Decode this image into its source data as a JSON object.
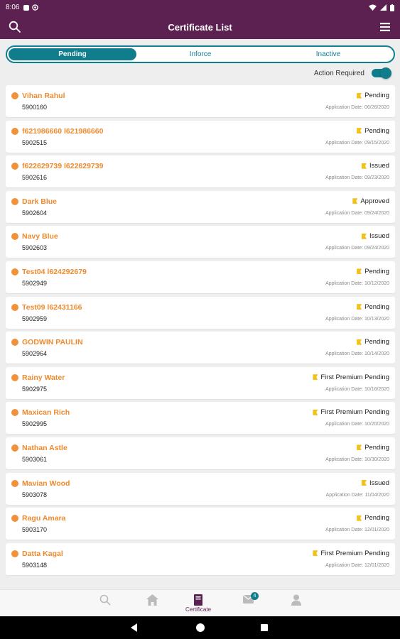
{
  "status_bar": {
    "time": "8:06"
  },
  "header": {
    "title": "Certificate List"
  },
  "tabs": [
    {
      "label": "Pending",
      "active": true
    },
    {
      "label": "Inforce",
      "active": false
    },
    {
      "label": "Inactive",
      "active": false
    }
  ],
  "filter": {
    "action_required_label": "Action Required",
    "action_required_on": true
  },
  "certificates": [
    {
      "name": "Vihan Rahul",
      "number": "5900160",
      "status": "Pending",
      "application_date": "Application Date: 06/26/2020"
    },
    {
      "name": "f621986660 l621986660",
      "number": "5902515",
      "status": "Pending",
      "application_date": "Application Date: 09/15/2020"
    },
    {
      "name": "f622629739 l622629739",
      "number": "5902616",
      "status": "Issued",
      "application_date": "Application Date: 09/23/2020"
    },
    {
      "name": "Dark Blue",
      "number": "5902604",
      "status": "Approved",
      "application_date": "Application Date: 09/24/2020"
    },
    {
      "name": "Navy Blue",
      "number": "5902603",
      "status": "Issued",
      "application_date": "Application Date: 09/24/2020"
    },
    {
      "name": "Test04 l624292679",
      "number": "5902949",
      "status": "Pending",
      "application_date": "Application Date: 10/12/2020"
    },
    {
      "name": "Test09 l62431166",
      "number": "5902959",
      "status": "Pending",
      "application_date": "Application Date: 10/13/2020"
    },
    {
      "name": "GODWIN PAULIN",
      "number": "5902964",
      "status": "Pending",
      "application_date": "Application Date: 10/14/2020"
    },
    {
      "name": "Rainy Water",
      "number": "5902975",
      "status": "First Premium Pending",
      "application_date": "Application Date: 10/16/2020"
    },
    {
      "name": "Maxican Rich",
      "number": "5902995",
      "status": "First Premium Pending",
      "application_date": "Application Date: 10/20/2020"
    },
    {
      "name": "Nathan Astle",
      "number": "5903061",
      "status": "Pending",
      "application_date": "Application Date: 10/30/2020"
    },
    {
      "name": "Mavian Wood",
      "number": "5903078",
      "status": "Issued",
      "application_date": "Application Date: 11/04/2020"
    },
    {
      "name": "Ragu Amara",
      "number": "5903170",
      "status": "Pending",
      "application_date": "Application Date: 12/01/2020"
    },
    {
      "name": "Datta Kagal",
      "number": "5903148",
      "status": "First Premium Pending",
      "application_date": "Application Date: 12/01/2020"
    }
  ],
  "bottom_nav": {
    "items": [
      {
        "icon": "search-icon",
        "label": ""
      },
      {
        "icon": "home-icon",
        "label": ""
      },
      {
        "icon": "certificate-icon",
        "label": "Certificate",
        "active": true
      },
      {
        "icon": "mail-icon",
        "label": "",
        "badge": "4"
      },
      {
        "icon": "profile-icon",
        "label": ""
      }
    ]
  },
  "colors": {
    "header": "#5c2150",
    "accent": "#0f7d8c",
    "name": "#ef8a2d",
    "flag": "#f2c21a"
  }
}
